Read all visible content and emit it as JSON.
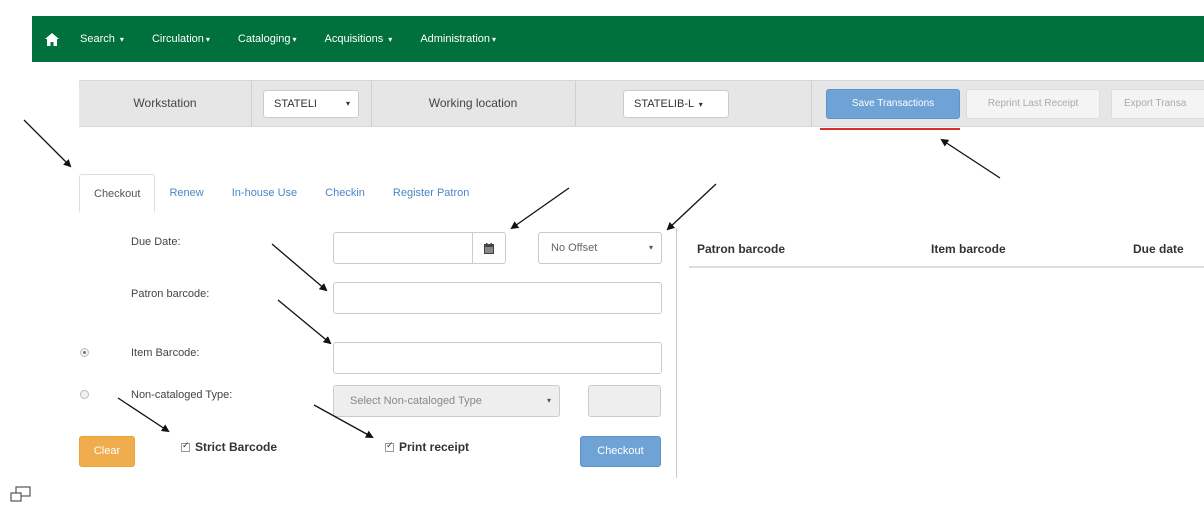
{
  "nav": {
    "items": [
      {
        "label": "Search",
        "caret": "▾"
      },
      {
        "label": "Circulation",
        "caret": "▾"
      },
      {
        "label": "Cataloging",
        "caret": "▾"
      },
      {
        "label": "Acquisitions",
        "caret": "▾"
      },
      {
        "label": "Administration",
        "caret": "▾"
      }
    ],
    "home_icon": "home-icon",
    "color": "#00703c"
  },
  "workstation_bar": {
    "workstation_label": "Workstation",
    "workstation_value": "STATELI",
    "working_location_label": "Working location",
    "working_location_value": "STATELIB-L",
    "save_transactions": "Save Transactions",
    "reprint_last_receipt": "Reprint Last Receipt",
    "export_transactions": "Export Transa"
  },
  "tabs": [
    {
      "label": "Checkout",
      "active": true
    },
    {
      "label": "Renew",
      "active": false
    },
    {
      "label": "In-house Use",
      "active": false
    },
    {
      "label": "Checkin",
      "active": false
    },
    {
      "label": "Register Patron",
      "active": false
    }
  ],
  "form": {
    "due_date_label": "Due Date:",
    "due_date_value": "",
    "offset_value": "No Offset",
    "patron_barcode_label": "Patron barcode:",
    "patron_barcode_value": "",
    "item_barcode_label": "Item Barcode:",
    "item_barcode_value": "",
    "noncat_label": "Non-cataloged Type:",
    "noncat_select": "Select Non-cataloged Type",
    "strict_barcode": "Strict Barcode",
    "print_receipt": "Print receipt",
    "clear_button": "Clear",
    "checkout_button": "Checkout"
  },
  "table": {
    "columns": [
      "Patron barcode",
      "Item barcode",
      "Due date"
    ]
  },
  "colors": {
    "primary": "#6fa3d6",
    "warning": "#f0ad4e",
    "highlight": "#d9302c"
  }
}
